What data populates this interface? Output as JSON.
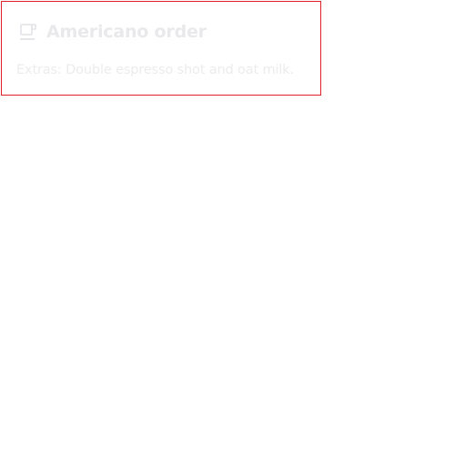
{
  "card": {
    "icon": "coffee-cup-icon",
    "title": "Americano order",
    "extras": "Extras: Double espresso shot and oat milk."
  },
  "colors": {
    "border": "#e01f2d",
    "text": "#e9e9ec"
  }
}
